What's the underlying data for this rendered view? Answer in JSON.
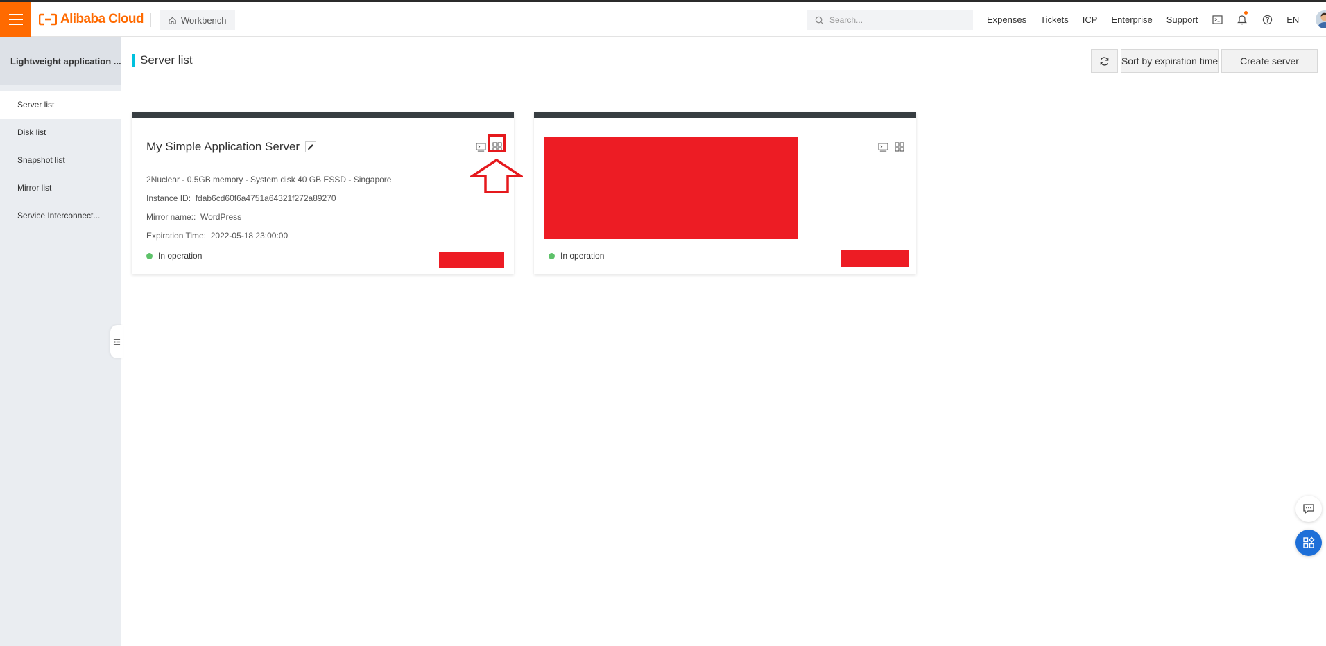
{
  "brand": {
    "name": "Alibaba Cloud",
    "accent": "#ff6a00"
  },
  "topbar": {
    "workbench_label": "Workbench",
    "search_placeholder": "Search...",
    "nav": [
      "Expenses",
      "Tickets",
      "ICP",
      "Enterprise",
      "Support"
    ],
    "language": "EN",
    "icons": [
      "terminal-icon",
      "bell-icon",
      "help-icon",
      "avatar"
    ]
  },
  "sidebar": {
    "title": "Lightweight application ...",
    "items": [
      {
        "label": "Server list",
        "active": true
      },
      {
        "label": "Disk list",
        "active": false
      },
      {
        "label": "Snapshot list",
        "active": false
      },
      {
        "label": "Mirror list",
        "active": false
      },
      {
        "label": "Service Interconnect...",
        "active": false
      }
    ]
  },
  "header": {
    "title": "Server list",
    "sort_label": "Sort by expiration time",
    "create_label": "Create server"
  },
  "cards": [
    {
      "title": "My Simple Application Server",
      "specs": "2Nuclear - 0.5GB memory - System disk 40 GB ESSD - Singapore",
      "instance_label": "Instance ID:",
      "instance_id": "fdab6cd60f6a4751a64321f272a89270",
      "mirror_label": "Mirror name::",
      "mirror_name": "WordPress",
      "expiration_label": "Expiration Time:",
      "expiration_time": "2022-05-18 23:00:00",
      "status": "In operation"
    },
    {
      "status": "In operation"
    }
  ],
  "colors": {
    "status_running": "#5ec26a",
    "redaction": "#ed1c24",
    "title_accent": "#00c1de",
    "float_primary": "#1d6fd8"
  }
}
